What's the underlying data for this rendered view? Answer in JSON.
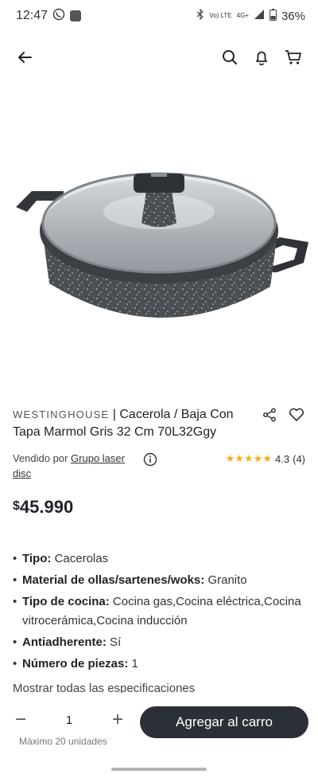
{
  "status": {
    "time": "12:47",
    "network": "4G+",
    "volte": "Vo) LTE",
    "battery": "36%"
  },
  "nav": {
    "icons": [
      "back-arrow-icon",
      "search-icon",
      "bell-icon",
      "cart-icon"
    ]
  },
  "product": {
    "brand": "WESTINGHOUSE",
    "separator": "|",
    "title": "Cacerola / Baja Con Tapa Marmol Gris 32 Cm 70L32Ggy",
    "seller_prefix": "Vendido por",
    "seller_name": "Grupo laser disc",
    "rating_value": "4.3",
    "rating_count": "(4)",
    "stars": "★★★★★",
    "currency": "$",
    "price": "45.990"
  },
  "specs": [
    {
      "label": "Tipo:",
      "value": "Cacerolas"
    },
    {
      "label": "Material de ollas/sartenes/woks:",
      "value": "Granito"
    },
    {
      "label": "Tipo de cocina:",
      "value": "Cocina gas,Cocina eléctrica,Cocina vitrocerámica,Cocina inducción"
    },
    {
      "label": "Antiadherente:",
      "value": "Sí"
    },
    {
      "label": "Número de piezas:",
      "value": "1"
    }
  ],
  "spec_cut": "Mostrar todas las especificaciones",
  "purchase": {
    "quantity": "1",
    "minus": "−",
    "plus": "+",
    "max_note": "Máximo 20 unidades",
    "add_to_cart": "Agregar al carro"
  },
  "colors": {
    "button_dark": "#2b3038",
    "star": "#f2b01e"
  }
}
